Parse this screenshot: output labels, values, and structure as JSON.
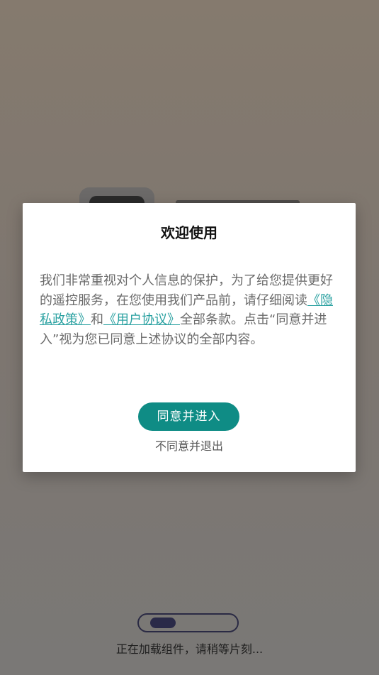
{
  "dialog": {
    "title": "欢迎使用",
    "body_part1": "我们非常重视对个人信息的保护，为了给您提供更好的遥控服务，在您使用我们产品前，请仔细阅读",
    "privacy_link": "《隐私政策》",
    "body_and": "和",
    "user_agreement_link": "《用户协议》",
    "body_part2": "全部条款。点击“同意并进入”视为您已同意上述协议的全部内容。",
    "agree_button": "同意并进入",
    "disagree_link": "不同意并退出"
  },
  "loading": {
    "progress": 0.25,
    "text": "正在加载组件，请稍等片刻..."
  },
  "colors": {
    "accent": "#0f8c85",
    "link": "#2aa1a1",
    "progress": "#2a2a48"
  }
}
